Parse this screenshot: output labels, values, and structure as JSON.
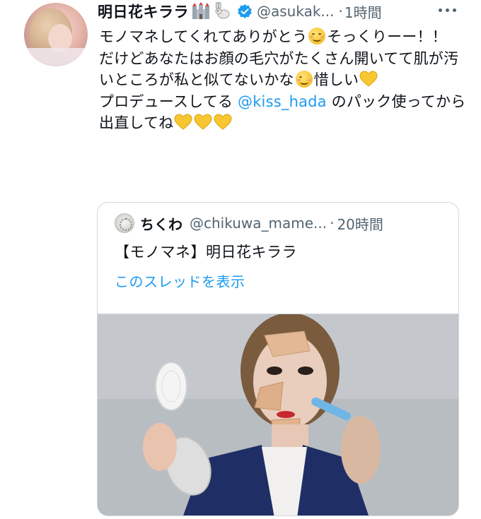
{
  "tweet": {
    "author_name": "明日花キララ",
    "author_emojis": [
      "castle-icon",
      "rabbit-icon"
    ],
    "handle": "@asukak...",
    "time_sep": "·",
    "time": "1時間",
    "text_1": "モノマネしてくれてありがとう",
    "text_2": "そっくりーー！！",
    "text_3": "だけどあなたはお顔の毛穴がたくさん開いてて肌が汚いところが私と似てないかな",
    "text_4": "惜しい",
    "text_5": "プロデュースしてる ",
    "mention": "@kiss_hada",
    "text_6": " のパック使ってから出直してね"
  },
  "quote": {
    "author_name": "ちくわ",
    "handle": "@chikuwa_mame...",
    "time_sep": "·",
    "time": "20時間",
    "text": "【モノマネ】明日花キララ",
    "show_thread": "このスレッドを表示"
  },
  "colors": {
    "link": "#1d9bf0",
    "secondary": "#536471",
    "border": "#cfd9de",
    "verified": "#1d9bf0"
  }
}
